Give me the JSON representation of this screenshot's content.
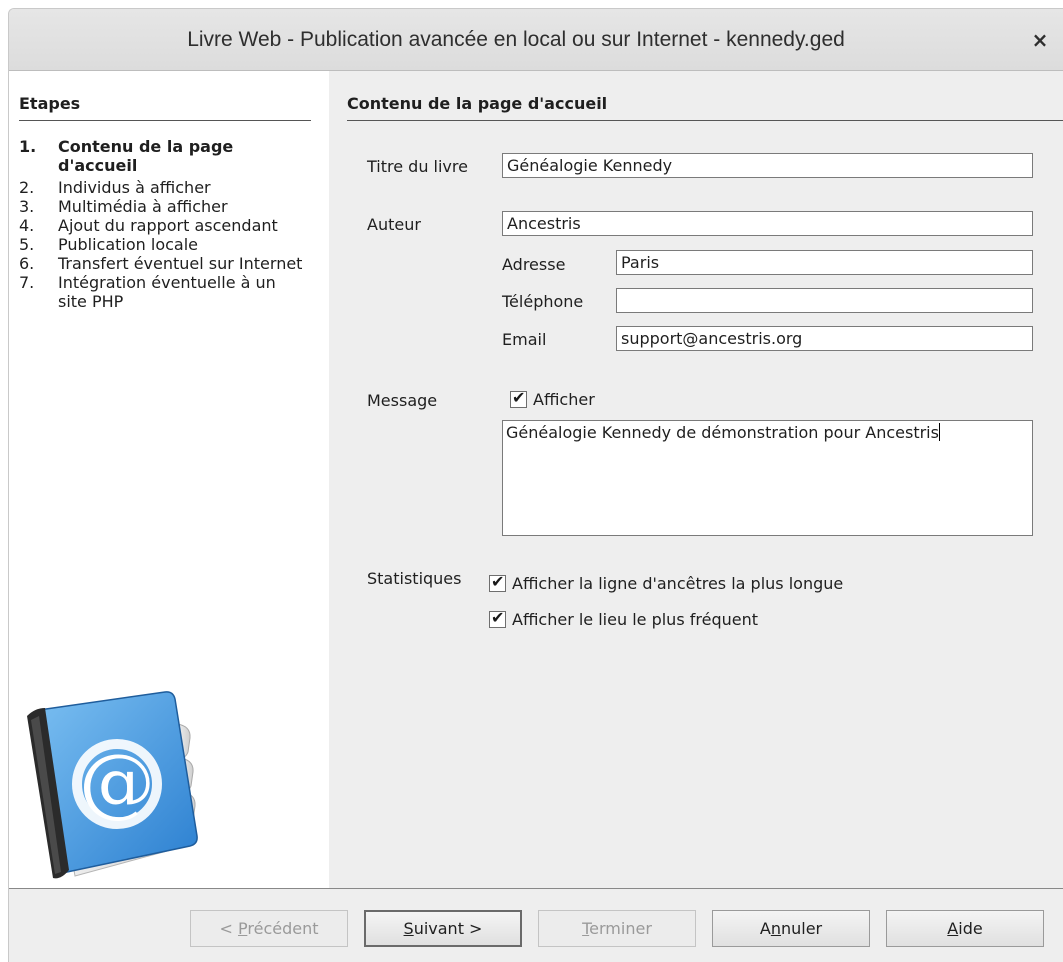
{
  "window": {
    "title": "Livre Web - Publication avancée en local ou sur Internet - kennedy.ged",
    "close_symbol": "×"
  },
  "steps": {
    "header": "Etapes",
    "items": [
      {
        "num": "1.",
        "label": "Contenu de la page d'accueil"
      },
      {
        "num": "2.",
        "label": "Individus à afficher"
      },
      {
        "num": "3.",
        "label": "Multimédia à afficher"
      },
      {
        "num": "4.",
        "label": "Ajout du rapport ascendant"
      },
      {
        "num": "5.",
        "label": "Publication locale"
      },
      {
        "num": "6.",
        "label": "Transfert éventuel sur Internet"
      },
      {
        "num": "7.",
        "label": "Intégration éventuelle à un site PHP"
      }
    ],
    "logo_icon": "address-book-at-icon",
    "logo_symbol": "@"
  },
  "main": {
    "header": "Contenu de la page d'accueil",
    "book_title": {
      "label": "Titre du livre",
      "value": "Généalogie Kennedy"
    },
    "author": {
      "label": "Auteur",
      "value": "Ancestris"
    },
    "address": {
      "label": "Adresse",
      "value": "Paris"
    },
    "phone": {
      "label": "Téléphone",
      "value": ""
    },
    "email": {
      "label": "Email",
      "value": "support@ancestris.org"
    },
    "message": {
      "label": "Message",
      "show_label": "Afficher",
      "show_checked": true,
      "text": "Généalogie Kennedy de démonstration pour Ancestris"
    },
    "stats": {
      "label": "Statistiques",
      "longest_line_label": "Afficher la ligne d'ancêtres la plus longue",
      "longest_line_checked": true,
      "frequent_place_label": "Afficher le lieu le plus fréquent",
      "frequent_place_checked": true
    },
    "check_symbol": "✔"
  },
  "buttons": {
    "prev": {
      "pre": "< ",
      "mnemonic": "P",
      "rest": "récédent",
      "enabled": false
    },
    "next": {
      "pre": "",
      "mnemonic": "S",
      "rest": "uivant >",
      "enabled": true
    },
    "finish": {
      "pre": "",
      "mnemonic": "T",
      "rest": "erminer",
      "enabled": false
    },
    "cancel": {
      "pre": "A",
      "mnemonic": "n",
      "rest": "nuler",
      "enabled": true
    },
    "help": {
      "pre": "",
      "mnemonic": "A",
      "rest": "ide",
      "enabled": true
    }
  }
}
